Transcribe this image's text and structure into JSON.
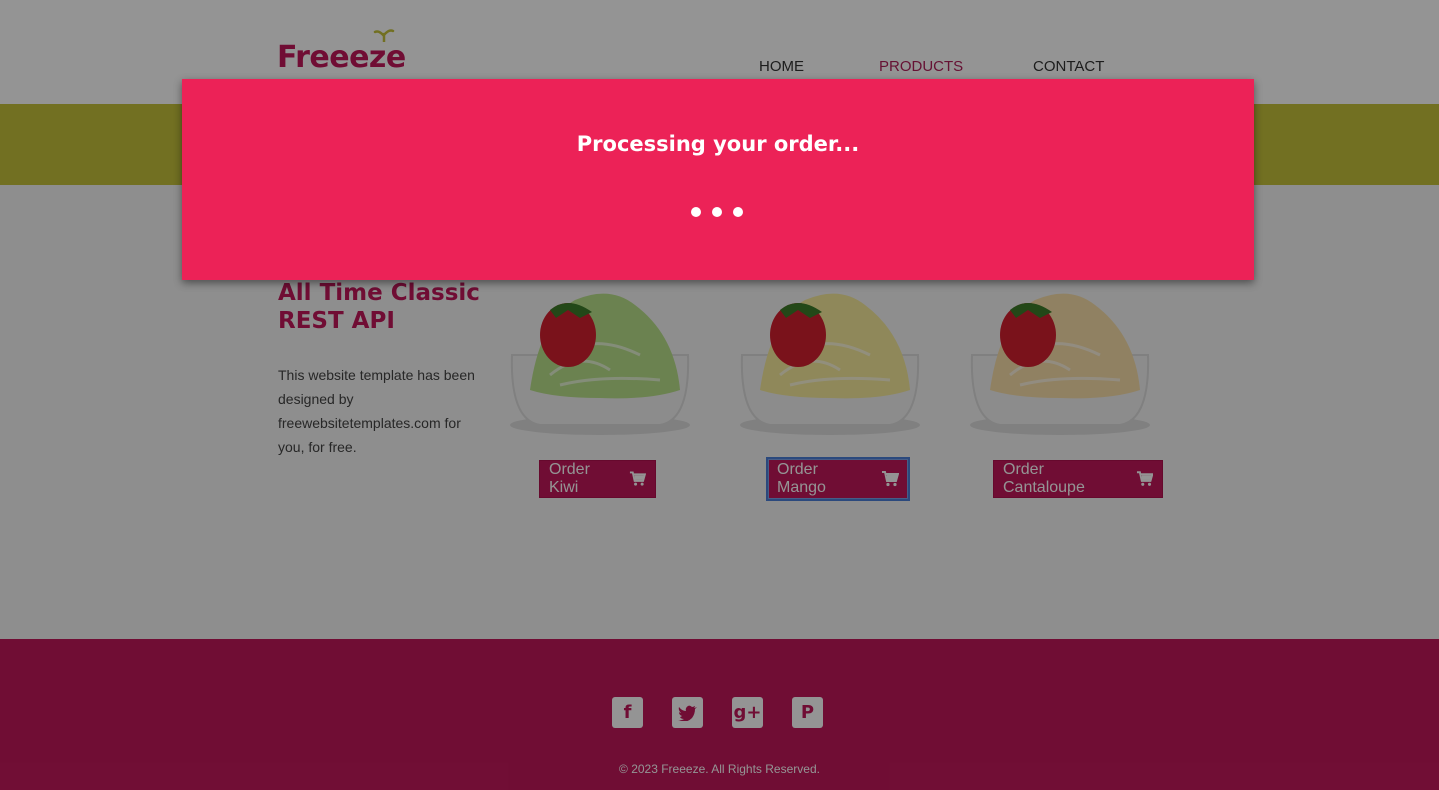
{
  "header": {
    "logo_text": "Freeeze",
    "nav": {
      "home": "HOME",
      "products": "PRODUCTS",
      "contact": "CONTACT"
    }
  },
  "main": {
    "title_line1": "All Time Classic",
    "title_line2": "REST API",
    "description": "This website template has been designed by freewebsitetemplates.com for you, for free.",
    "products": [
      {
        "name": "Kiwi",
        "button_label": "Order Kiwi",
        "cream_color": "#b8e08a"
      },
      {
        "name": "Mango",
        "button_label": "Order Mango",
        "cream_color": "#f6eb9c"
      },
      {
        "name": "Cantaloupe",
        "button_label": "Order Cantaloupe",
        "cream_color": "#f8dfaa"
      }
    ]
  },
  "footer": {
    "social": [
      "facebook-icon",
      "twitter-icon",
      "google-plus-icon",
      "pinterest-icon"
    ],
    "copyright": "© 2023 Freeeze. All Rights Reserved."
  },
  "modal": {
    "title": "Processing your order...",
    "dots": 3
  },
  "colors": {
    "brand": "#c2185b",
    "modal": "#ec2257",
    "banner": "#c4c23c",
    "focus": "#4a7fd8"
  }
}
